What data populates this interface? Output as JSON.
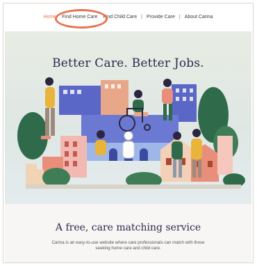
{
  "nav": {
    "items": [
      {
        "label": "Home",
        "active": true
      },
      {
        "label": "Find Home Care",
        "active": false
      },
      {
        "label": "Find Child Care",
        "active": false
      },
      {
        "label": "Provide Care",
        "active": false
      },
      {
        "label": "About Carina",
        "active": false
      }
    ],
    "separator": "|"
  },
  "hero": {
    "title": "Better Care. Better Jobs."
  },
  "intro": {
    "title": "A free, care matching service",
    "description": "Carina is an easy-to-use website where care professionals can match with those seeking home care and child care."
  },
  "colors": {
    "accent": "#e8734f",
    "heading": "#2c2a4a",
    "hero_bg": "#e3eae6",
    "green": "#2f6b4a",
    "blue": "#5a67c7"
  },
  "icons": [
    "wheelchair-icon"
  ]
}
